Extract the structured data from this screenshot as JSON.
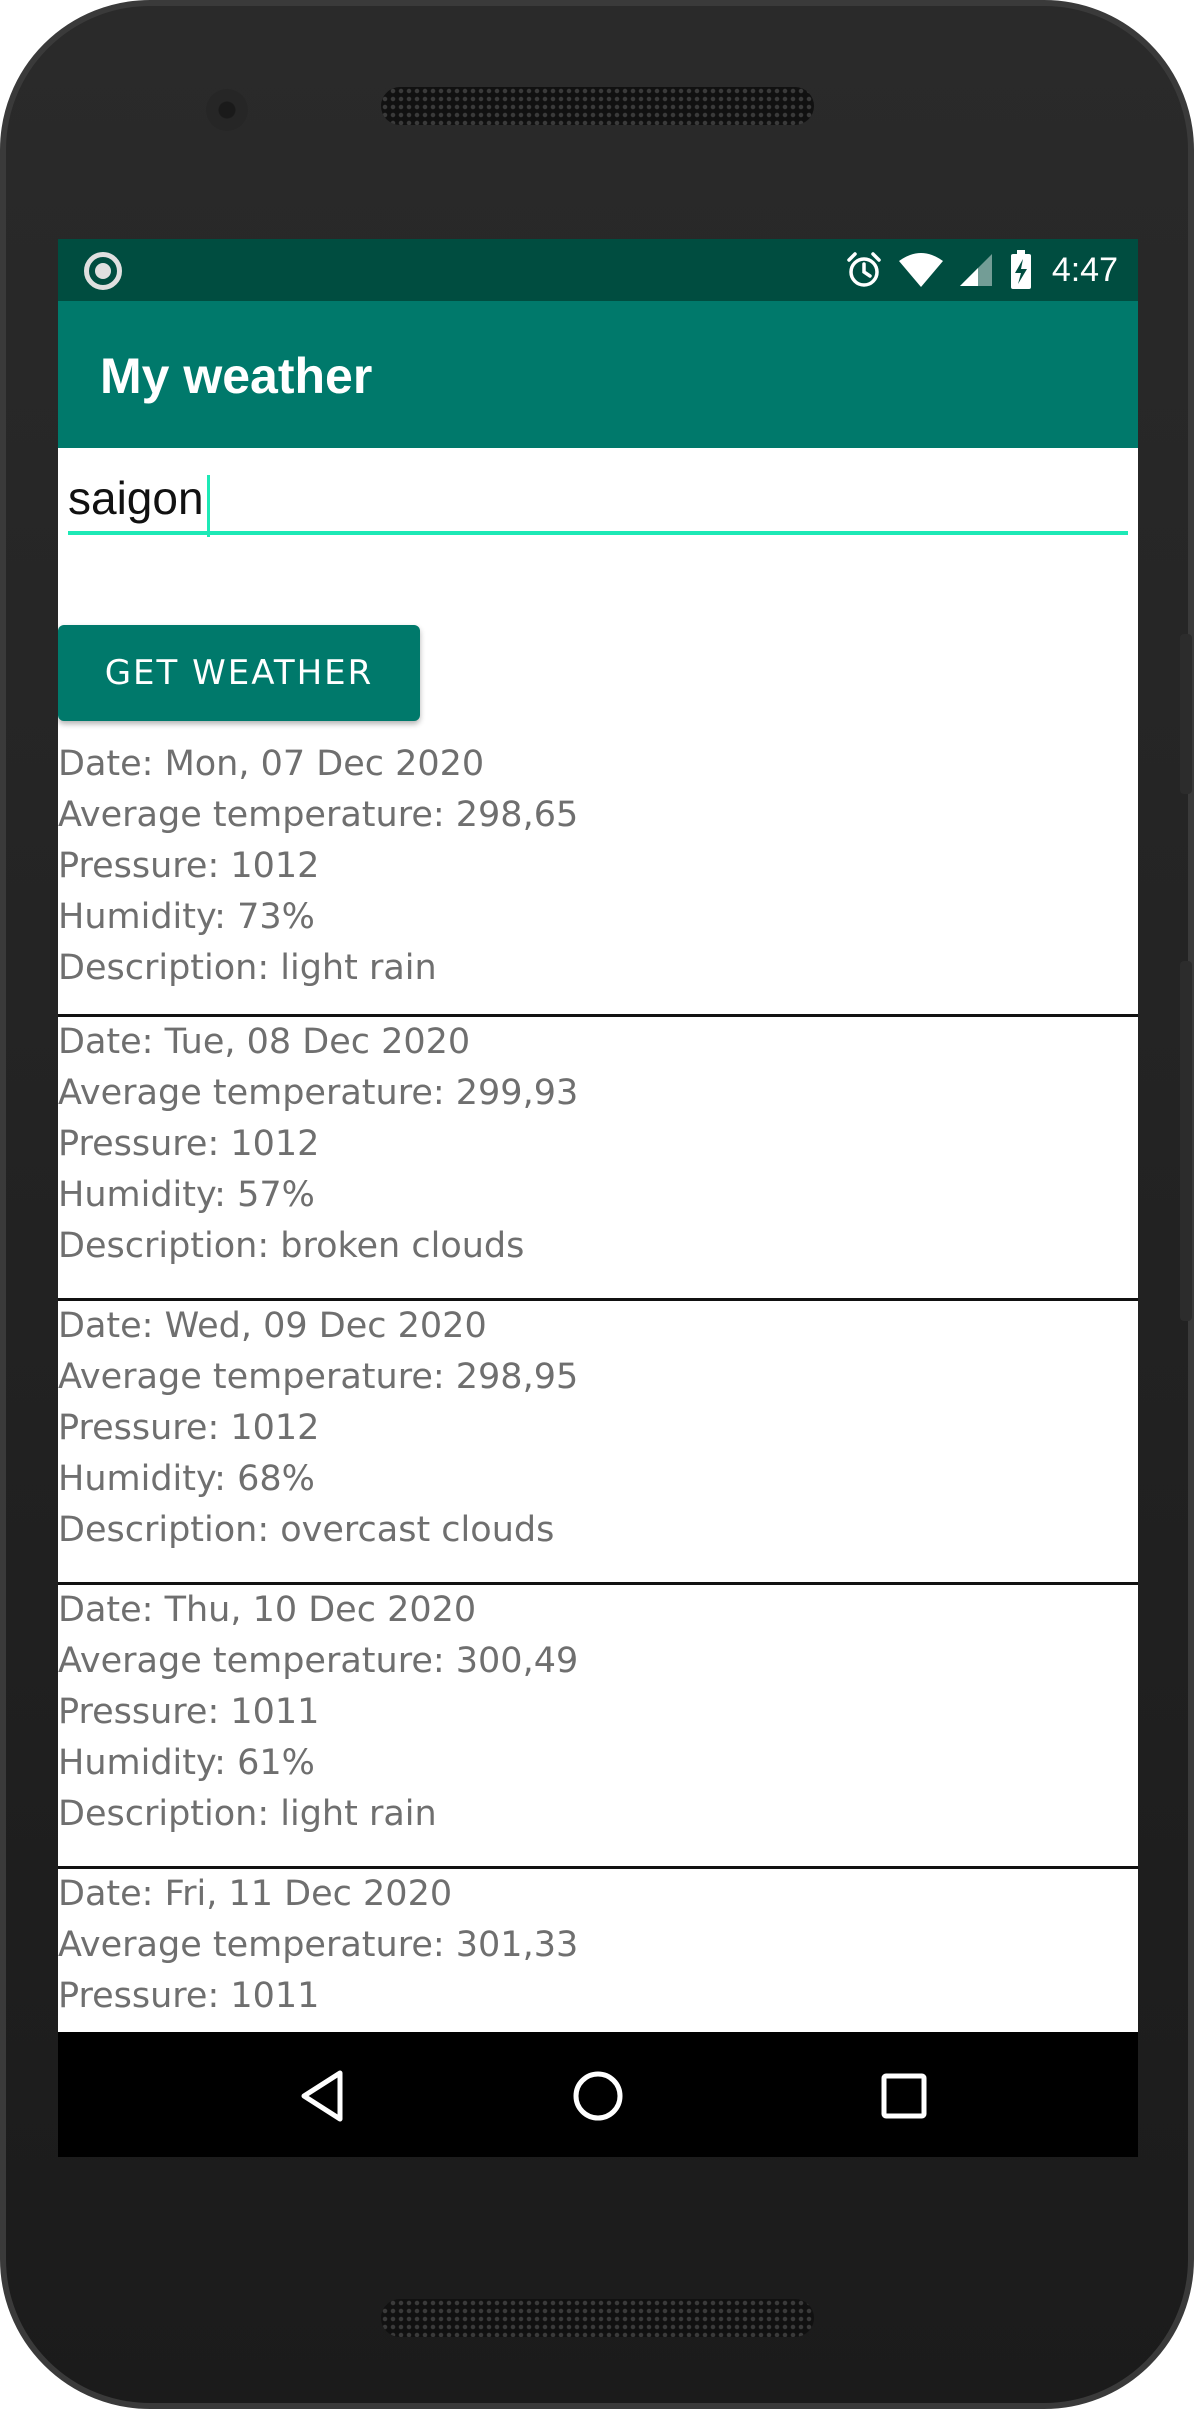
{
  "status_bar": {
    "time": "4:47",
    "icons": [
      "notification-dot-icon",
      "alarm-icon",
      "wifi-icon",
      "cell-signal-icon",
      "battery-charging-icon"
    ]
  },
  "app_bar": {
    "title": "My weather"
  },
  "search": {
    "value": "saigon",
    "placeholder": ""
  },
  "button": {
    "label": "GET WEATHER"
  },
  "forecast": [
    {
      "date": "Date: Mon, 07 Dec 2020",
      "temp": "Average temperature: 298,65",
      "pressure": "Pressure: 1012",
      "humidity": "Humidity: 73%",
      "description": "Description: light rain"
    },
    {
      "date": "Date: Tue, 08 Dec 2020",
      "temp": "Average temperature: 299,93",
      "pressure": "Pressure: 1012",
      "humidity": "Humidity: 57%",
      "description": "Description: broken clouds"
    },
    {
      "date": "Date: Wed, 09 Dec 2020",
      "temp": "Average temperature: 298,95",
      "pressure": "Pressure: 1012",
      "humidity": "Humidity: 68%",
      "description": "Description: overcast clouds"
    },
    {
      "date": "Date: Thu, 10 Dec 2020",
      "temp": "Average temperature: 300,49",
      "pressure": "Pressure: 1011",
      "humidity": "Humidity: 61%",
      "description": "Description: light rain"
    },
    {
      "date": "Date: Fri, 11 Dec 2020",
      "temp": "Average temperature: 301,33",
      "pressure": "Pressure: 1011"
    }
  ],
  "nav": {
    "icons": [
      "back-icon",
      "home-icon",
      "recents-icon"
    ]
  },
  "colors": {
    "status_bar": "#004d40",
    "primary": "#00796b",
    "accent": "#1de9b6",
    "secondary_text": "#6f6f6f"
  }
}
